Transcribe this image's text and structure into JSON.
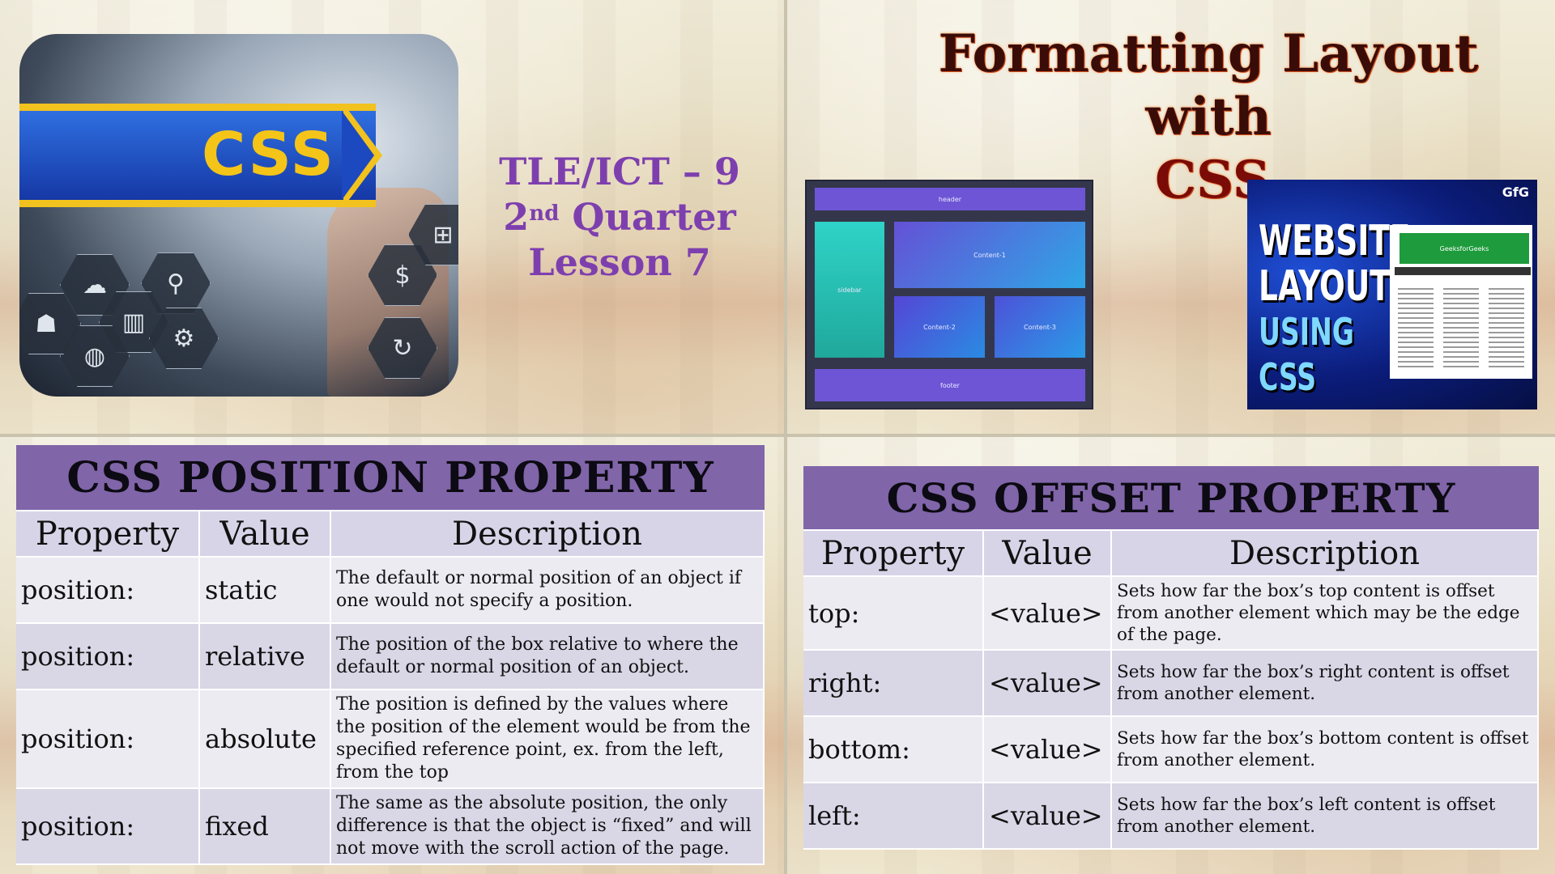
{
  "slide1": {
    "css_logo_text": "CSS",
    "hex_icons": [
      "cloud-icon",
      "search-icon",
      "chart-icon",
      "gear-icon",
      "globe-icon",
      "dollar-icon",
      "refresh-icon",
      "hierarchy-icon",
      "people-icon"
    ],
    "lesson": {
      "line1": "TLE/ICT – 9",
      "quarter_num": "2",
      "quarter_sup": "nd",
      "quarter_word": "Quarter",
      "line3": "Lesson 7"
    }
  },
  "slide2": {
    "title_line1": "Formatting Layout",
    "title_line2": "with",
    "title_line3": "CSS",
    "diagram": {
      "header": "header",
      "sidebar": "sidebar",
      "content1": "Content-1",
      "content2": "Content-2",
      "content3": "Content-3",
      "footer": "footer"
    },
    "thumbnail": {
      "line1": "WEBSITE",
      "line2": "LAYOUT",
      "line3": "USING CSS",
      "logo": "GfG",
      "page_header": "GeeksforGeeks"
    }
  },
  "position_table": {
    "title": "CSS POSITION PROPERTY",
    "headers": [
      "Property",
      "Value",
      "Description"
    ],
    "rows": [
      {
        "property": "position:",
        "value": "static",
        "description": "The default or normal position of an object if one would not specify a position."
      },
      {
        "property": "position:",
        "value": "relative",
        "description": "The position of the box relative to where the default or normal position of an object."
      },
      {
        "property": "position:",
        "value": "absolute",
        "description": "The position is defined by the values where the position of the element would be from the specified reference point, ex. from the left, from the top"
      },
      {
        "property": "position:",
        "value": "fixed",
        "description": "The same as the absolute position, the only difference is that the object is “fixed” and will not move with the scroll action of the page."
      }
    ]
  },
  "offset_table": {
    "title": "CSS OFFSET PROPERTY",
    "headers": [
      "Property",
      "Value",
      "Description"
    ],
    "rows": [
      {
        "property": "top:",
        "value": "<value>",
        "description": "Sets how far the box’s top content is offset from another element which may be the edge of the page."
      },
      {
        "property": "right:",
        "value": "<value>",
        "description": "Sets how far the box’s right content is offset from another element."
      },
      {
        "property": "bottom:",
        "value": "<value>",
        "description": "Sets how far the box’s bottom content is offset from another element."
      },
      {
        "property": "left:",
        "value": "<value>",
        "description": "Sets how far the box’s left content is offset from another element."
      }
    ]
  },
  "colors": {
    "table_title_bg": "#8065a9",
    "lesson_text": "#7e3fae",
    "title_text": "#3a0c08"
  }
}
